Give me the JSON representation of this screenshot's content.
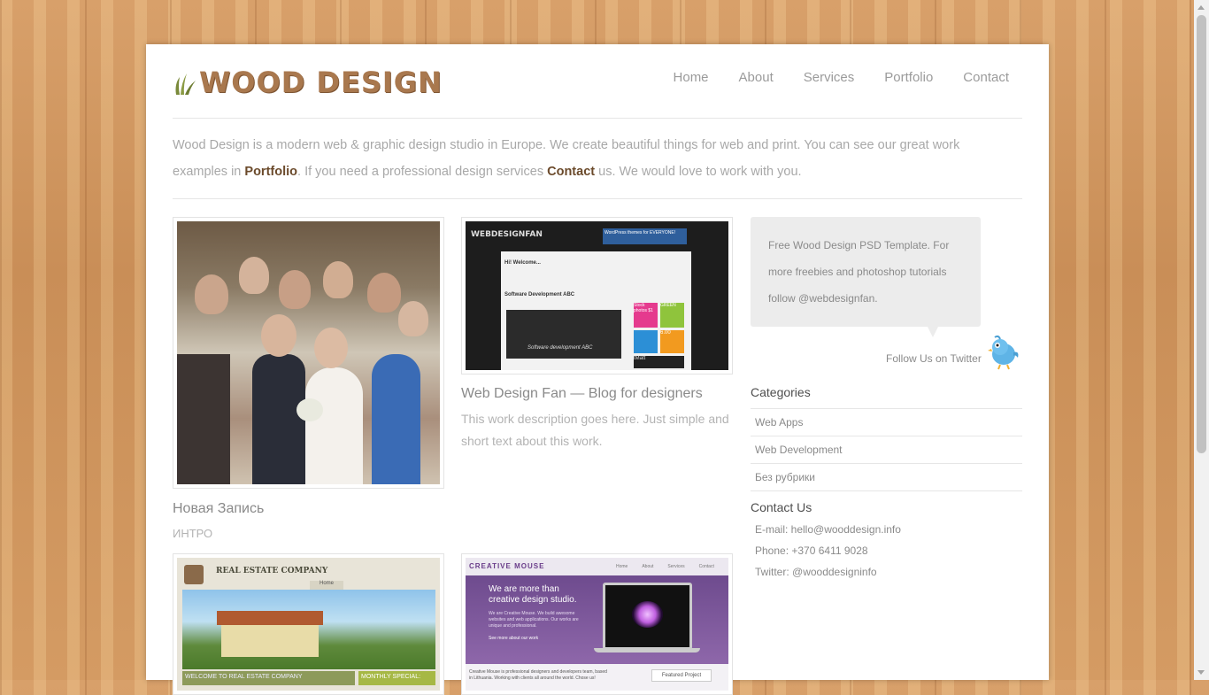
{
  "site": {
    "logo_text": "WOOD DESIGN",
    "nav": [
      "Home",
      "About",
      "Services",
      "Portfolio",
      "Contact"
    ]
  },
  "intro": {
    "part1": "Wood Design is a modern web & graphic design studio in Europe. We create beautiful things for web and print. You can see our great work examples in",
    "link1": "Portfolio",
    "part2": ". If you need a professional design services ",
    "link2": "Contact",
    "part3": " us. We would love to work with you."
  },
  "posts": [
    {
      "title": "Новая Запись",
      "meta": "ИНТРО",
      "image": "wedding-photo"
    },
    {
      "title": "Web Design Fan — Blog for designers",
      "desc": "This work description goes here. Just simple and short text about this work.",
      "image": "webdesignfan-screenshot",
      "image_text": {
        "logo": "WEBDESIGNFAN",
        "banner": "WordPress themes for EVERYONE!",
        "welcome": "Hi! Welcome...",
        "article": "Software Development ABC",
        "caption": "Software development ABC",
        "ad1": "Stock photos $1",
        "ad2": "GREEN",
        "ad3": "6.00",
        "ad4": "tMatt"
      }
    },
    {
      "image": "real-estate-screenshot",
      "image_text": {
        "brand": "REAL ESTATE COMPANY",
        "tab": "Home",
        "welcome": "WELCOME TO REAL ESTATE COMPANY",
        "special": "MONTHLY SPECIAL:"
      }
    },
    {
      "image": "creative-mouse-screenshot",
      "image_text": {
        "brand": "CREATIVE MOUSE",
        "nav": [
          "Home",
          "About",
          "Services",
          "Contact"
        ],
        "headline1": "We are more than",
        "headline2": "creative design studio.",
        "body": "We are Creative Mouse. We build awesome websites and web applications. Our works are unique and professional.",
        "link": "See more about our work",
        "footer": "Creative Mouse is professional designers and developers team, based in Lithuania. Working with clients all around the world. Chose us!",
        "button": "Featured Project"
      }
    }
  ],
  "sidebar": {
    "tweet": "Free Wood Design PSD Template. For more freebies and photoshop tutorials follow @webdesignfan.",
    "follow": "Follow Us on Twitter",
    "categories_title": "Categories",
    "categories": [
      "Web Apps",
      "Web Development",
      "Без рубрики"
    ],
    "contact_title": "Contact Us",
    "contact": {
      "email": "E-mail: hello@wooddesign.info",
      "phone": "Phone: +370 6411 9028",
      "twitter": "Twitter: @wooddesigninfo"
    }
  },
  "colors": {
    "accent": "#a9784e",
    "link": "#6b4a2b",
    "text_muted": "#a8a8a8"
  }
}
